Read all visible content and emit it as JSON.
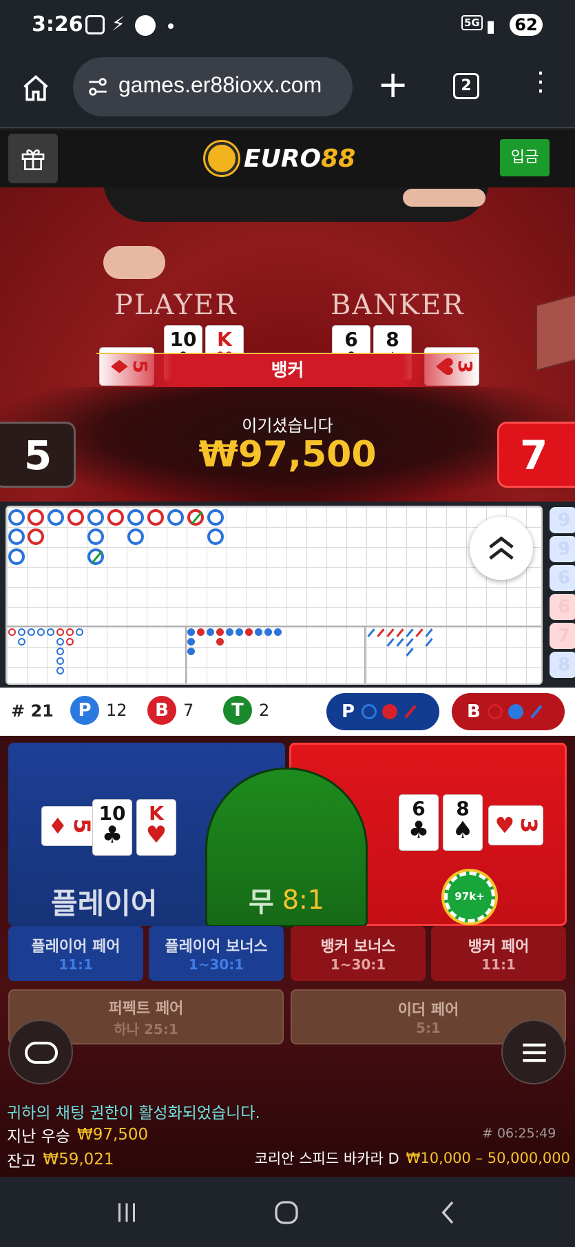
{
  "status_bar": {
    "time": "3:26",
    "network": "5G",
    "battery": "62"
  },
  "browser": {
    "url": "games.er88ioxx.com",
    "tab_count": "2"
  },
  "site": {
    "logo_text_a": "EURO",
    "logo_text_b": "88",
    "deposit_label": "입금"
  },
  "video": {
    "player_title": "PLAYER",
    "banker_title": "BANKER",
    "winner_banner": "뱅커",
    "win_message": "이기셨습니다",
    "win_amount": "₩97,500",
    "player_score": "5",
    "banker_score": "7"
  },
  "stats": {
    "round": "# 21",
    "p_label": "P",
    "p_count": "12",
    "b_label": "B",
    "b_count": "7",
    "t_label": "T",
    "t_count": "2",
    "predict_p": "P",
    "predict_b": "B"
  },
  "bets": {
    "player_label": "플레이어",
    "tie_label": "무",
    "tie_odds": "8:1",
    "chip_amount": "97k+",
    "player_pair": "플레이어 페어",
    "player_pair_odds": "11:1",
    "player_bonus": "플레이어 보너스",
    "player_bonus_odds": "1~30:1",
    "banker_bonus": "뱅커 보너스",
    "banker_bonus_odds": "1~30:1",
    "banker_pair": "뱅커 페어",
    "banker_pair_odds": "11:1",
    "perfect_pair": "퍼펙트 페어",
    "perfect_pair_odds": "하나 25:1",
    "either_pair": "이더 페어",
    "either_pair_odds": "5:1"
  },
  "player_cards": [
    {
      "rank": "5",
      "suit": "♦"
    },
    {
      "rank": "10",
      "suit": "♣"
    },
    {
      "rank": "K",
      "suit": "♥"
    }
  ],
  "banker_cards": [
    {
      "rank": "6",
      "suit": "♣"
    },
    {
      "rank": "8",
      "suit": "♠"
    },
    {
      "rank": "3",
      "suit": "♥"
    }
  ],
  "footer": {
    "chat_notice": "귀하의 채팅 권한이 활성화되었습니다.",
    "last_win_label": "지난 우승",
    "last_win_amount": "₩97,500",
    "round_time": "# 06:25:49",
    "balance_label": "잔고",
    "balance_amount": "₩59,021",
    "table_name": "코리안 스피드 바카라 D",
    "limits": "₩10,000 – 50,000,000"
  },
  "side_badges": [
    "9",
    "9",
    "6",
    "6",
    "7",
    "8"
  ],
  "colors": {
    "player_blue": "#1647a8",
    "banker_red": "#d10f12",
    "tie_green": "#1d7a1d",
    "gold": "#f7c32a"
  }
}
